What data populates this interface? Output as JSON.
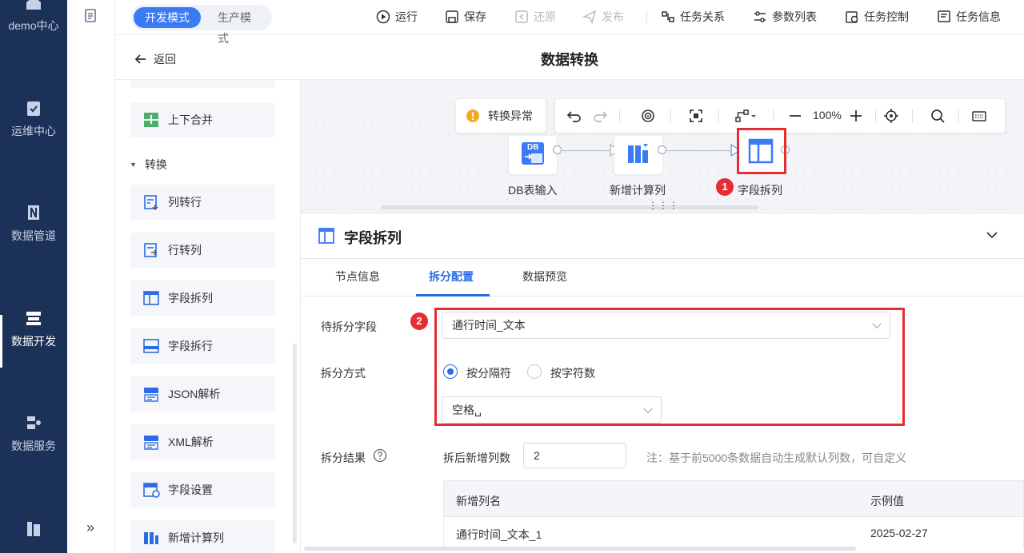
{
  "nav": {
    "items": [
      {
        "label": "demo中心",
        "icon": "home-icon"
      },
      {
        "label": "运维中心",
        "icon": "clipboard-check-icon"
      },
      {
        "label": "数据管道",
        "icon": "pipeline-icon"
      },
      {
        "label": "数据开发",
        "icon": "data-dev-icon"
      },
      {
        "label": "数据服务",
        "icon": "data-service-icon"
      },
      {
        "label": "",
        "icon": "report-icon"
      }
    ],
    "expand_glyph": "»"
  },
  "mode": {
    "dev": "开发模式",
    "prod": "生产模式"
  },
  "toolbar": {
    "run": "运行",
    "save": "保存",
    "restore": "还原",
    "publish": "发布",
    "task_relation": "任务关系",
    "param_list": "参数列表",
    "task_control": "任务控制",
    "task_info": "任务信息"
  },
  "titlebar": {
    "back": "返回",
    "title": "数据转换"
  },
  "ops": {
    "merge_vertical": "上下合并",
    "section": "转换",
    "col_to_row": "列转行",
    "row_to_col": "行转列",
    "field_split_col": "字段拆列",
    "field_split_row": "字段拆行",
    "json_parse": "JSON解析",
    "xml_parse": "XML解析",
    "field_settings": "字段设置",
    "add_calc_col": "新增计算列"
  },
  "canvas": {
    "warning": "转换异常",
    "zoom": "100%",
    "nodes": {
      "db_input": "DB表输入",
      "calc_col": "新增计算列",
      "split_col": "字段拆列"
    },
    "db_icon_text": "DB",
    "badge1": "1"
  },
  "panel": {
    "title": "字段拆列",
    "tabs": [
      "节点信息",
      "拆分配置",
      "数据预览"
    ],
    "badge2": "2",
    "field_label": "待拆分字段",
    "field_value": "通行时间_文本",
    "method_label": "拆分方式",
    "method_opt1": "按分隔符",
    "method_opt2": "按字符数",
    "delimiter_value": "空格␣",
    "result_label": "拆分结果",
    "new_cols_label": "拆后新增列数",
    "new_cols_value": "2",
    "note": "注：基于前5000条数据自动生成默认列数，可自定义",
    "table": {
      "headers": [
        "新增列名",
        "示例值"
      ],
      "rows": [
        [
          "通行时间_文本_1",
          "2025-02-27"
        ]
      ]
    }
  },
  "colors": {
    "nav_bg": "#1c3157",
    "accent": "#3a7af5",
    "highlight": "#e52d33"
  }
}
